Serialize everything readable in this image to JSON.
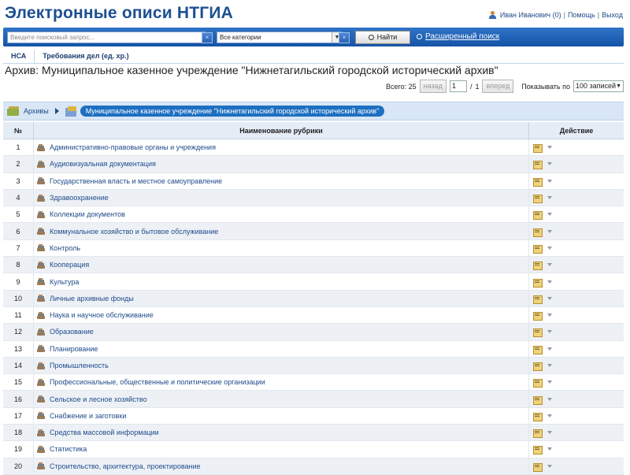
{
  "header": {
    "logo": "Электронные описи НТГИА",
    "user": "Иван Иванович (0)",
    "help": "Помощь",
    "logout": "Выход",
    "divider": "|"
  },
  "search": {
    "placeholder": "Введите поисковый запрос...",
    "clear_glyph": "×",
    "category": "Все категории",
    "find_label": "Найти",
    "advanced_label": "Расширенный поиск"
  },
  "tabs": [
    {
      "label": "НСА"
    },
    {
      "label": "Требования дел (ед. хр.)"
    }
  ],
  "page_title": "Архив: Муниципальное казенное учреждение \"Нижнетагильский городской исторический архив\"",
  "pager": {
    "total_label": "Всего: 25",
    "prev": "назад",
    "current_page": "1",
    "page_sep": "/",
    "page_count": "1",
    "next": "вперед",
    "show_label": "Показывать по",
    "per_page": "100 записей"
  },
  "breadcrumb": {
    "root": "Архивы",
    "current": "Муниципальное казенное учреждение \"Нижнетагильский городской исторический архив\""
  },
  "table": {
    "headers": {
      "num": "№",
      "name": "Наименование рубрики",
      "action": "Действие"
    },
    "rows": [
      {
        "num": "1",
        "name": "Административно-правовые органы и учреждения"
      },
      {
        "num": "2",
        "name": "Аудиовизуальная документация"
      },
      {
        "num": "3",
        "name": "Государственная власть и местное самоуправление"
      },
      {
        "num": "4",
        "name": "Здравоохранение"
      },
      {
        "num": "5",
        "name": "Коллекции документов"
      },
      {
        "num": "6",
        "name": "Коммунальное хозяйство и бытовое обслуживание"
      },
      {
        "num": "7",
        "name": "Контроль"
      },
      {
        "num": "8",
        "name": "Кооперация"
      },
      {
        "num": "9",
        "name": "Культура"
      },
      {
        "num": "10",
        "name": "Личные архивные фонды"
      },
      {
        "num": "11",
        "name": "Наука и научное обслуживание"
      },
      {
        "num": "12",
        "name": "Образование"
      },
      {
        "num": "13",
        "name": "Планирование"
      },
      {
        "num": "14",
        "name": "Промышленность"
      },
      {
        "num": "15",
        "name": "Профессиональные, общественные и политические организации"
      },
      {
        "num": "16",
        "name": "Сельское и лесное хозяйство"
      },
      {
        "num": "17",
        "name": "Снабжение и заготовки"
      },
      {
        "num": "18",
        "name": "Средства массовой информации"
      },
      {
        "num": "19",
        "name": "Статистика"
      },
      {
        "num": "20",
        "name": "Строительство, архитектура, проектирование"
      }
    ]
  }
}
